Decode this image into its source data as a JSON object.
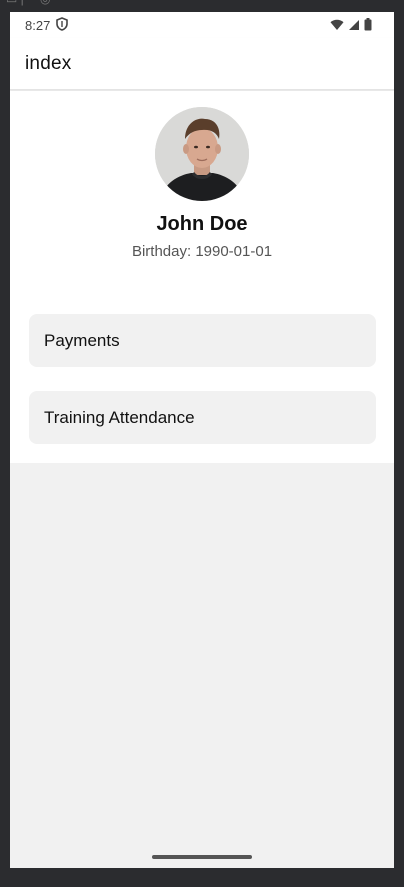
{
  "status_bar": {
    "time": "8:27",
    "shield_icon": "shield-icon",
    "wifi_icon": "wifi-icon",
    "signal_icon": "cell-signal-icon",
    "battery_icon": "battery-icon"
  },
  "app_bar": {
    "title": "index"
  },
  "profile": {
    "avatar_icon": "avatar-photo",
    "name": "John Doe",
    "birthday": "Birthday: 1990-01-01"
  },
  "menu": {
    "items": [
      {
        "label": "Payments"
      },
      {
        "label": "Training Attendance"
      }
    ]
  },
  "colors": {
    "screen_background": "#f1f1f1",
    "card_background": "#f1f1f1",
    "surface": "#ffffff",
    "frame": "#2b2c2f"
  }
}
